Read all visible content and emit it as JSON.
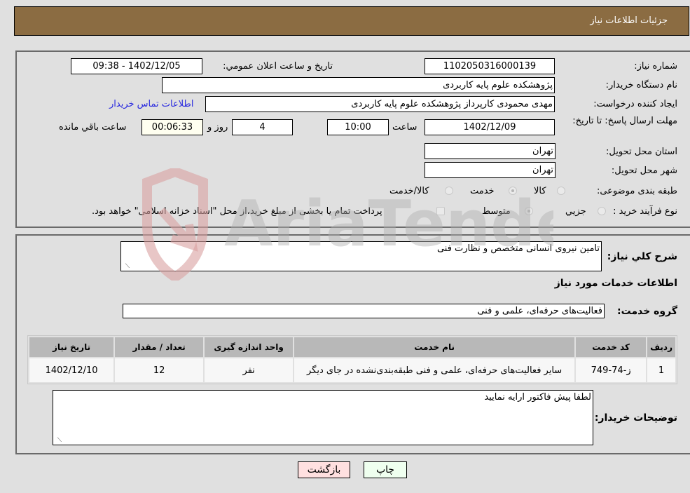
{
  "header": {
    "title": "جزئیات اطلاعات نیاز"
  },
  "colors": {
    "header_bg": "#8b6c42",
    "page_bg": "#e0e0e0",
    "link": "#2a2adf",
    "print_button_bg": "#efffef",
    "back_button_bg": "#ffe0e0"
  },
  "fields": {
    "need_number": {
      "label": "شماره نیاز:",
      "value": "1102050316000139"
    },
    "announce_datetime": {
      "label": "تاریخ و ساعت اعلان عمومي:",
      "value": "1402/12/05 - 09:38"
    },
    "buyer_org": {
      "label": "نام دستگاه خريدار:",
      "value": "پژوهشکده علوم پایه کاربردی"
    },
    "requester": {
      "label": "ايجاد کننده درخواست:",
      "value": "مهدی محمودی کارپرداز پژوهشکده علوم پایه کاربردی"
    },
    "buyer_contact_link": "اطلاعات تماس خريدار",
    "deadline": {
      "label": "مهلت ارسال پاسخ: تا تاریخ:",
      "date": "1402/12/09",
      "time_label": "ساعت",
      "time": "10:00",
      "days": "4",
      "days_label": "روز و",
      "remaining": "00:06:33",
      "remaining_label": "ساعت باقي مانده"
    },
    "province": {
      "label": "استان محل تحويل:",
      "value": "تهران"
    },
    "city": {
      "label": "شهر محل تحويل:",
      "value": "تهران"
    },
    "category": {
      "label": "طبقه بندی موضوعی:",
      "options": [
        "کالا",
        "خدمت",
        "کالا/خدمت"
      ],
      "selected": "خدمت"
    },
    "purchase_type": {
      "label": "نوع فرآيند خريد :",
      "options": [
        "جزيي",
        "متوسط"
      ],
      "selected": "متوسط",
      "treasury_note": "پرداخت تمام يا بخشی از مبلغ خريد،از محل \"اسناد خزانه اسلامی\" خواهد بود."
    }
  },
  "description": {
    "label": "شرح کلي نياز:",
    "value": "تامین نیروی انسانی متخصص و نظارت فنی"
  },
  "services_section": {
    "title": "اطلاعات خدمات مورد نياز",
    "group_label": "گروه خدمت:",
    "group_value": "فعالیت‌های حرفه‌ای، علمی و فنی",
    "table": {
      "headers": [
        "رديف",
        "کد خدمت",
        "نام خدمت",
        "واحد اندازه گيری",
        "تعداد / مقدار",
        "تاريخ نياز"
      ],
      "rows": [
        [
          "1",
          "ز-74-749",
          "سایر فعالیت‌های حرفه‌ای، علمی و فنی طبقه‌بندی‌نشده در جای دیگر",
          "نفر",
          "12",
          "1402/12/10"
        ]
      ]
    }
  },
  "buyer_notes": {
    "label": "توضيحات خريدار:",
    "value": "لطفا پیش فاکتور ارایه نمایید"
  },
  "buttons": {
    "print": "چاپ",
    "back": "بازگشت"
  },
  "watermark": "AriaTender.neT"
}
